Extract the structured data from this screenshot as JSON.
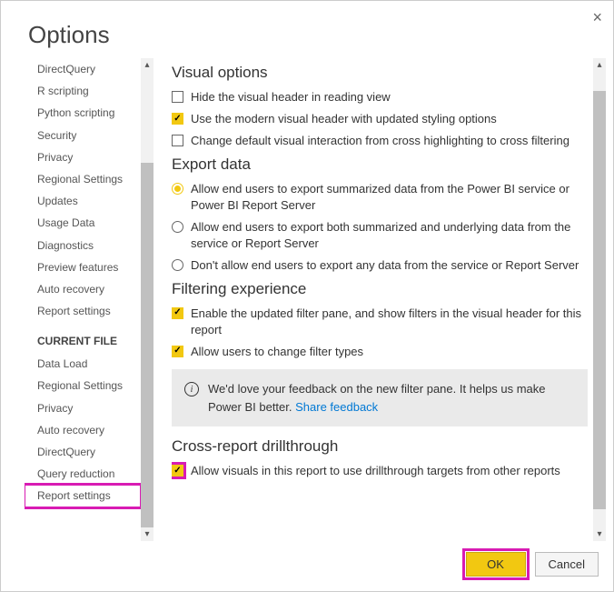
{
  "dialog": {
    "title": "Options"
  },
  "sidebar": {
    "global_items": [
      "DirectQuery",
      "R scripting",
      "Python scripting",
      "Security",
      "Privacy",
      "Regional Settings",
      "Updates",
      "Usage Data",
      "Diagnostics",
      "Preview features",
      "Auto recovery",
      "Report settings"
    ],
    "section_header": "CURRENT FILE",
    "file_items": [
      "Data Load",
      "Regional Settings",
      "Privacy",
      "Auto recovery",
      "DirectQuery",
      "Query reduction",
      "Report settings"
    ]
  },
  "content": {
    "visual": {
      "heading": "Visual options",
      "opt1": "Hide the visual header in reading view",
      "opt2": "Use the modern visual header with updated styling options",
      "opt3": "Change default visual interaction from cross highlighting to cross filtering"
    },
    "export": {
      "heading": "Export data",
      "opt1": "Allow end users to export summarized data from the Power BI service or Power BI Report Server",
      "opt2": "Allow end users to export both summarized and underlying data from the service or Report Server",
      "opt3": "Don't allow end users to export any data from the service or Report Server"
    },
    "filter": {
      "heading": "Filtering experience",
      "opt1": "Enable the updated filter pane, and show filters in the visual header for this report",
      "opt2": "Allow users to change filter types"
    },
    "feedback": {
      "text": "We'd love your feedback on the new filter pane. It helps us make Power BI better. ",
      "link": "Share feedback"
    },
    "cross": {
      "heading": "Cross-report drillthrough",
      "opt1": "Allow visuals in this report to use drillthrough targets from other reports"
    }
  },
  "footer": {
    "ok": "OK",
    "cancel": "Cancel"
  }
}
